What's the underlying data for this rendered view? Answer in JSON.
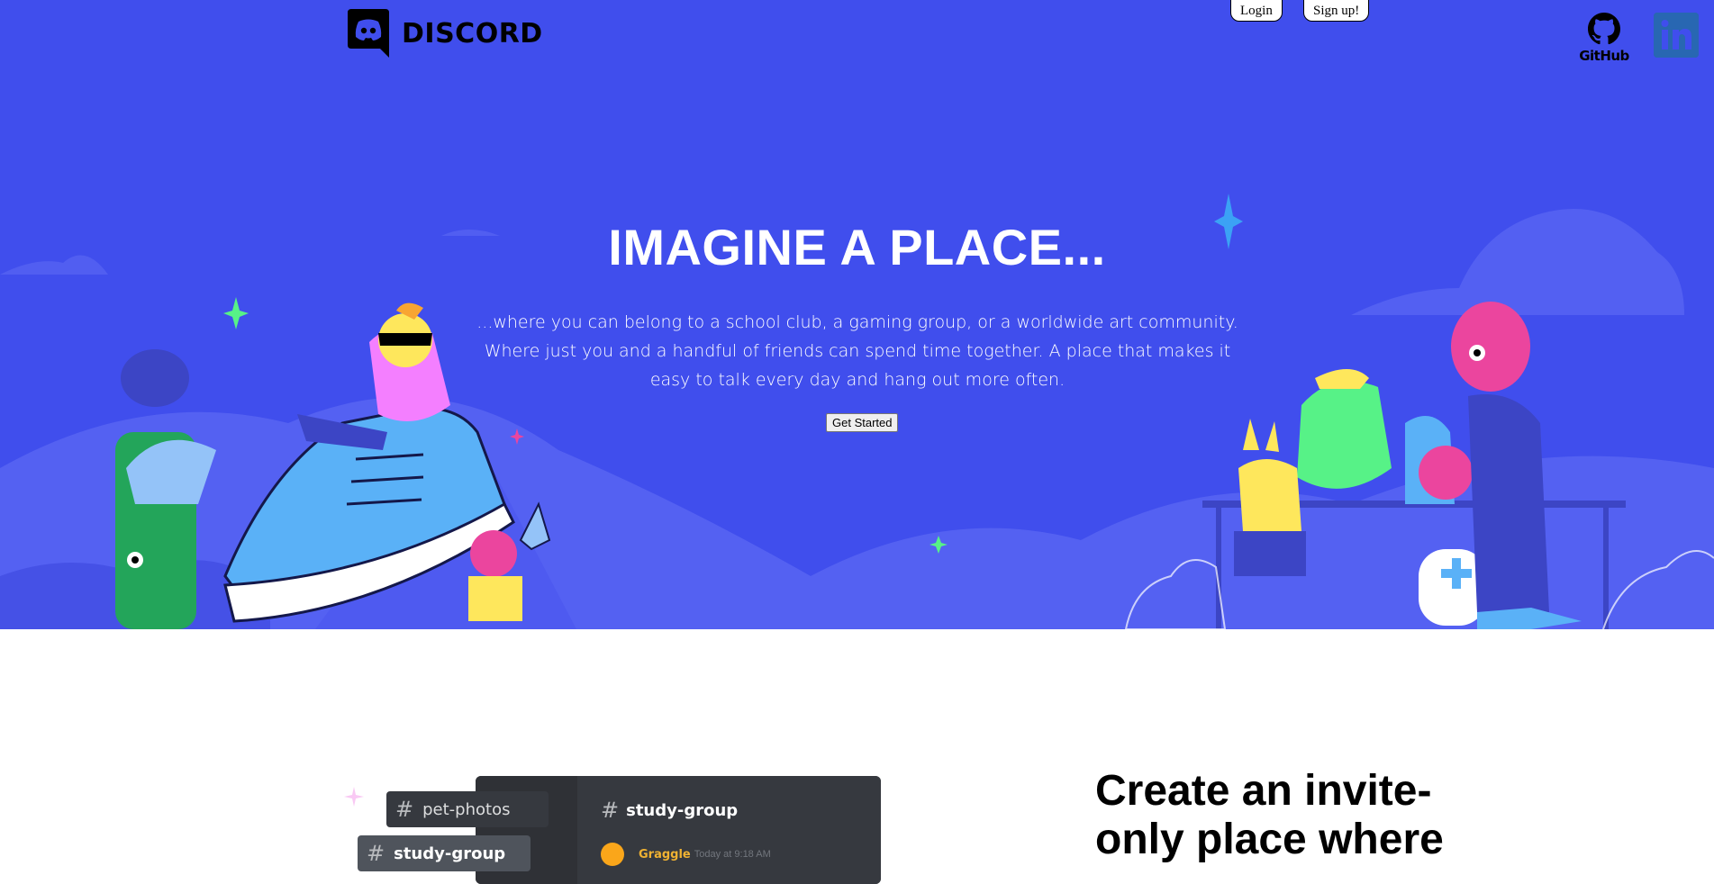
{
  "brand": {
    "name": "DISCORD"
  },
  "nav": {
    "login_label": "Login",
    "signup_label": "Sign up!"
  },
  "social": {
    "github_label": "GitHub",
    "linkedin_label": "in"
  },
  "hero": {
    "title": "IMAGINE A PLACE...",
    "description": "...where you can belong to a school club, a gaming group, or a worldwide art community. Where just you and a handful of friends can spend time together. A place that makes it easy to talk every day and hang out more often.",
    "cta_label": "Get Started"
  },
  "feature": {
    "title": "Create an invite-only place where",
    "mockup": {
      "channel_title": "study-group",
      "channels": [
        "pet-photos",
        "study-group"
      ],
      "message_user": "Graggle",
      "message_time": "Today at 9:18 AM"
    }
  },
  "colors": {
    "hero_bg": "#404eed",
    "text_light": "#ffffff",
    "mock_bg": "#36393f"
  }
}
